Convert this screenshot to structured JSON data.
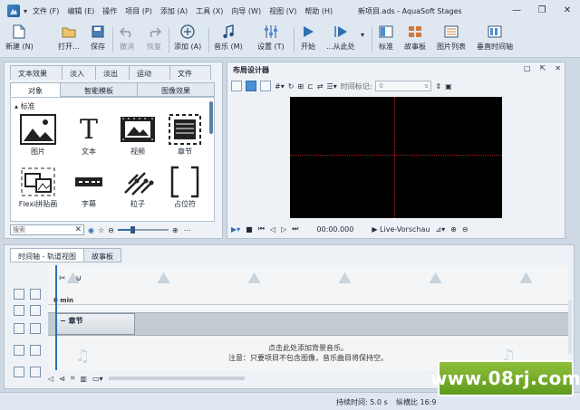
{
  "window": {
    "title": "新项目.ads - AquaSoft Stages",
    "controls": [
      "—",
      "❐",
      "✕"
    ]
  },
  "menu": [
    "文件 (F)",
    "编辑 (E)",
    "操作",
    "项目 (P)",
    "添加 (A)",
    "工具 (X)",
    "向导 (W)",
    "视图 (V)",
    "帮助 (H)"
  ],
  "toolbar": {
    "new": "新建 (N)",
    "open": "打开...",
    "save": "保存",
    "undo": "撤消",
    "redo": "恢复",
    "add": "添加 (A)",
    "music": "音乐 (M)",
    "settings": "设置 (T)",
    "start": "开始",
    "from_here": "...从此处",
    "standard": "标准",
    "storyboard": "故事板",
    "image_list": "图片列表",
    "vertical_timeline": "垂直时间轴"
  },
  "left_panel": {
    "tabs_top": [
      "文本效果",
      "淡入",
      "淡出",
      "运动",
      "文件"
    ],
    "tabs_bottom": [
      "对象",
      "智能模板",
      "图像效果"
    ],
    "section": "标准",
    "objects": [
      "图片",
      "文本",
      "视频",
      "章节",
      "Flexi拼贴画",
      "字幕",
      "粒子",
      "占位符"
    ],
    "search_placeholder": "搜索"
  },
  "designer": {
    "title": "布局设计器",
    "time_label": "时间标记:",
    "time_value": "0",
    "time_unit": "s",
    "timecode": "00:00.000",
    "preview": "Live-Vorschau"
  },
  "timeline": {
    "tabs": [
      "时间轴 - 轨道视图",
      "故事板"
    ],
    "ruler_label": "0 min",
    "chapter": "章节",
    "message_line1": "点击此处添加背景音乐。",
    "message_line2": "注意：只要项目不包含图像，音乐曲目将保持空。"
  },
  "status": {
    "duration": "持续时间: 5.0 s",
    "ratio": "纵横比 16:9"
  },
  "badge_text": "www.08rj.com",
  "colors": {
    "accent": "#2f6fb1",
    "canvas": "#000000",
    "badge": "#6aa626"
  }
}
